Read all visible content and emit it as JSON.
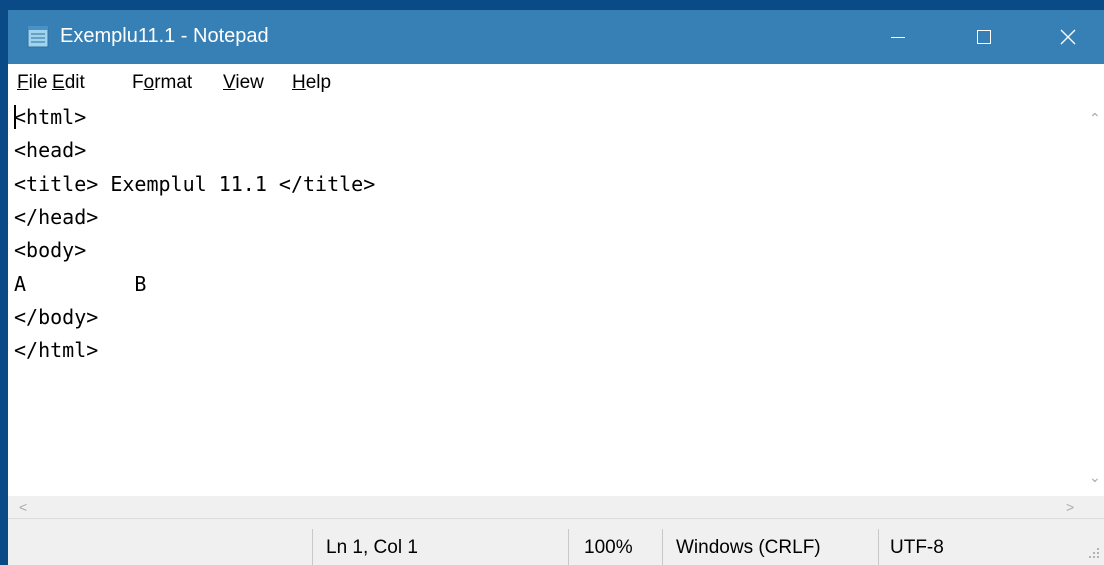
{
  "window": {
    "title": "Exemplu11.1 - Notepad",
    "accent_color": "#3780b5",
    "icon": "notepad-icon",
    "controls": [
      "minimize-icon",
      "maximize-icon",
      "close-icon"
    ]
  },
  "menu": {
    "file": {
      "accel": "F",
      "rest": "ile"
    },
    "edit": {
      "accel": "E",
      "rest": "dit"
    },
    "format": {
      "pre": "F",
      "accel": "o",
      "rest": "rmat"
    },
    "view": {
      "accel": "V",
      "rest": "iew"
    },
    "help": {
      "accel": "H",
      "rest": "elp"
    }
  },
  "editor": {
    "lines": [
      "<html>",
      "<head>",
      "<title> Exemplul 11.1 </title>",
      "</head>",
      "<body>",
      "A         B",
      "</body>",
      "</html>"
    ]
  },
  "status": {
    "position": "Ln 1, Col 1",
    "zoom": "100%",
    "line_ending": "Windows (CRLF)",
    "encoding": "UTF-8"
  }
}
